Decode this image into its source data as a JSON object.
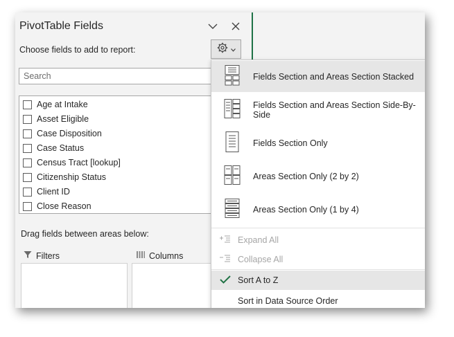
{
  "pane": {
    "title": "PivotTable Fields",
    "subtitle": "Choose fields to add to report:",
    "search_placeholder": "Search",
    "fields": [
      "Age at Intake",
      "Asset Eligible",
      "Case Disposition",
      "Case Status",
      "Census Tract [lookup]",
      "Citizenship Status",
      "Client ID",
      "Close Reason"
    ],
    "drag_label": "Drag fields between areas below:",
    "areas": {
      "filters": "Filters",
      "columns": "Columns"
    },
    "icons": {
      "collapse": "chevron-down-icon",
      "close": "close-icon",
      "gear": "gear-icon"
    }
  },
  "menu": {
    "layout_items": [
      "Fields Section and Areas Section Stacked",
      "Fields Section and Areas Section Side-By-Side",
      "Fields Section Only",
      "Areas Section Only (2 by 2)",
      "Areas Section Only (1 by 4)"
    ],
    "expand_all": "Expand All",
    "collapse_all": "Collapse All",
    "sort_az": "Sort A to Z",
    "sort_source": "Sort in Data Source Order",
    "accent": "#217346"
  }
}
